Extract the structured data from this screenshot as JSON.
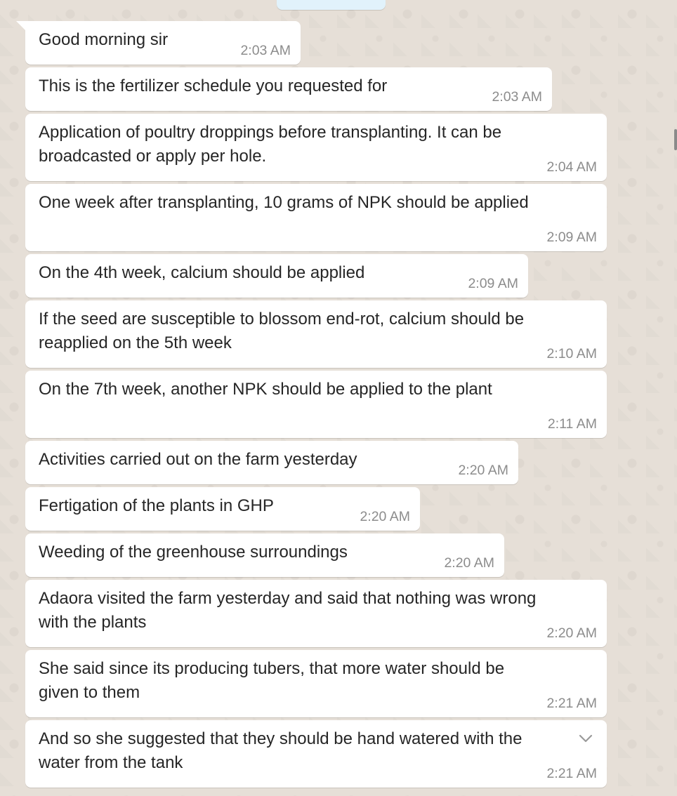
{
  "messages": [
    {
      "text": "Good morning sir",
      "time": "2:03 AM"
    },
    {
      "text": "This is the fertilizer schedule you requested for",
      "time": "2:03 AM"
    },
    {
      "text": "Application of poultry droppings before transplanting. It can be",
      "text2": "broadcasted or apply per hole.",
      "time": "2:04 AM"
    },
    {
      "text": "One week after transplanting, 10 grams of NPK should be applied",
      "time": "2:09 AM"
    },
    {
      "text": "On the 4th week,  calcium should be applied",
      "time": "2:09 AM"
    },
    {
      "text": "If the seed are susceptible to blossom end-rot,  calcium should be",
      "text2": "reapplied on the 5th week",
      "time": "2:10 AM"
    },
    {
      "text": "On the 7th week,  another NPK should be applied to the plant",
      "time": "2:11 AM"
    },
    {
      "text": "Activities carried out on the farm yesterday",
      "time": "2:20 AM"
    },
    {
      "text": "Fertigation of the plants in GHP",
      "time": "2:20 AM"
    },
    {
      "text": "Weeding of the greenhouse surroundings",
      "time": "2:20 AM"
    },
    {
      "text": "Adaora visited the farm yesterday and said that nothing was wrong",
      "text2": "with the plants",
      "time": "2:20 AM"
    },
    {
      "text": "She said since its producing tubers, that more water should be",
      "text2": "given to them",
      "time": "2:21 AM"
    },
    {
      "text": "And so she suggested that they should be hand watered with the",
      "text2": "water from the tank",
      "time": "2:21 AM"
    }
  ],
  "icons": {
    "message_menu": "chevron-down-icon"
  },
  "colors": {
    "background": "#e5ddd5",
    "bubble": "#ffffff",
    "text": "#262626",
    "timestamp": "#8c8c8c"
  }
}
